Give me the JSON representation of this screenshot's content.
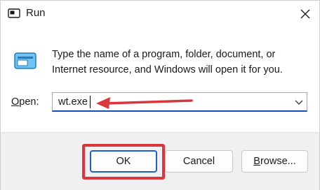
{
  "window": {
    "title": "Run"
  },
  "icons": {
    "title_icon": "run-dialog-icon",
    "app_icon": "run-program-icon",
    "close": "close-icon",
    "dropdown": "chevron-down-icon"
  },
  "dialog": {
    "description": "Type the name of a program, folder, document, or Internet resource, and Windows will open it for you.",
    "open_label_accel": "O",
    "open_label_rest": "pen:",
    "open_value": "wt.exe"
  },
  "buttons": {
    "ok": "OK",
    "cancel": "Cancel",
    "browse_accel": "B",
    "browse_rest": "rowse..."
  },
  "colors": {
    "annotation": "#d9363e",
    "focus_accent": "#0f4fb3"
  }
}
